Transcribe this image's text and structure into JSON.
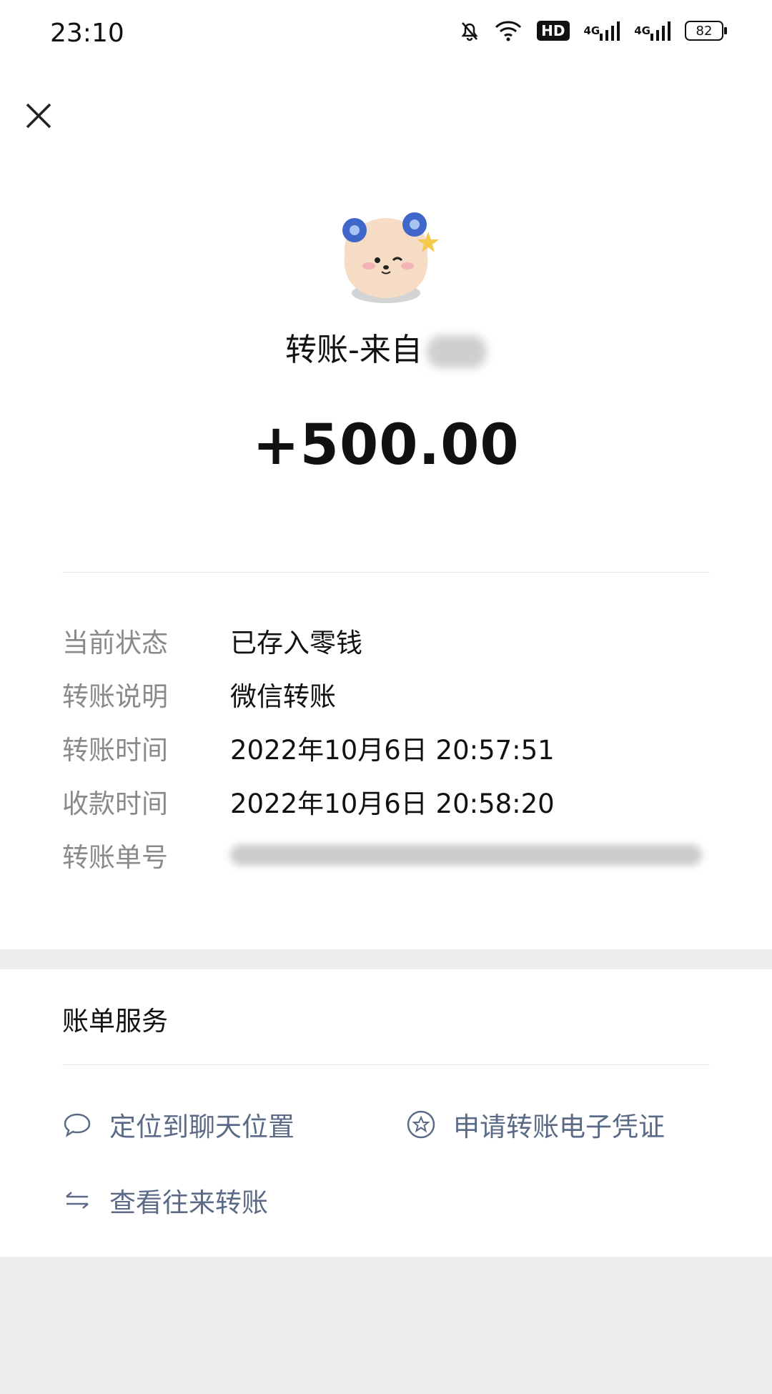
{
  "status_bar": {
    "time": "23:10",
    "network_1": "4G",
    "network_2": "4G",
    "hd_label": "HD",
    "battery": "82",
    "icons": [
      "bell-off-icon",
      "wifi-icon",
      "hd-icon",
      "signal-icon",
      "signal-icon",
      "battery-icon"
    ]
  },
  "header": {
    "close_icon": "close-icon"
  },
  "transfer": {
    "title": "转账-来自",
    "amount": "+500.00"
  },
  "details": [
    {
      "label": "当前状态",
      "value": "已存入零钱"
    },
    {
      "label": "转账说明",
      "value": "微信转账"
    },
    {
      "label": "转账时间",
      "value": "2022年10月6日 20:57:51"
    },
    {
      "label": "收款时间",
      "value": "2022年10月6日 20:58:20"
    },
    {
      "label": "转账单号",
      "value": ""
    }
  ],
  "services": {
    "title": "账单服务",
    "items": [
      {
        "label": "定位到聊天位置",
        "icon": "chat-bubble-icon"
      },
      {
        "label": "申请转账电子凭证",
        "icon": "star-badge-icon"
      },
      {
        "label": "查看往来转账",
        "icon": "transfer-arrows-icon"
      }
    ]
  },
  "colors": {
    "link": "#5b6b87",
    "label_gray": "#8a8a8a",
    "page_bg": "#ededed"
  }
}
